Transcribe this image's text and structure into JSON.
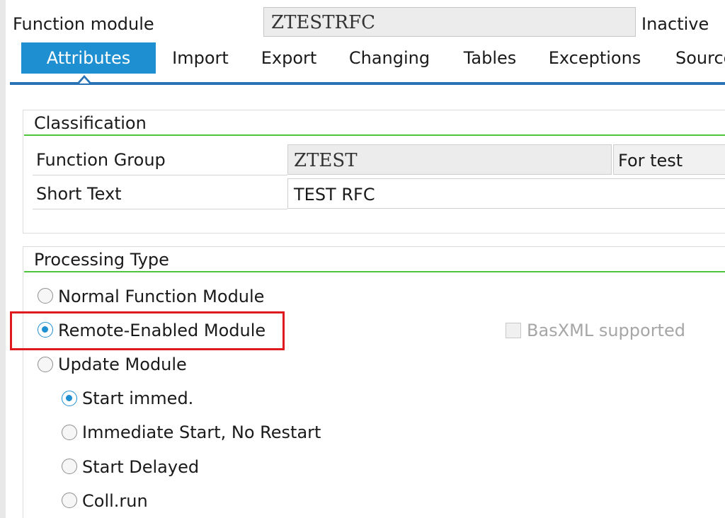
{
  "header": {
    "label": "Function module",
    "value": "ZTESTRFC",
    "status": "Inactive"
  },
  "tabs": [
    {
      "label": "Attributes",
      "active": true
    },
    {
      "label": "Import"
    },
    {
      "label": "Export"
    },
    {
      "label": "Changing"
    },
    {
      "label": "Tables"
    },
    {
      "label": "Exceptions"
    },
    {
      "label": "Source"
    }
  ],
  "classification": {
    "title": "Classification",
    "function_group_label": "Function Group",
    "function_group_value": "ZTEST",
    "function_group_desc": "For test",
    "short_text_label": "Short Text",
    "short_text_value": "TEST RFC"
  },
  "processing": {
    "title": "Processing Type",
    "options": [
      {
        "label": "Normal Function Module",
        "selected": false
      },
      {
        "label": "Remote-Enabled Module",
        "selected": true
      },
      {
        "label": "Update Module",
        "selected": false
      }
    ],
    "basxml_label": "BasXML supported",
    "basxml_checked": false,
    "update_options": [
      {
        "label": "Start immed.",
        "selected": true
      },
      {
        "label": "Immediate Start, No Restart",
        "selected": false
      },
      {
        "label": "Start Delayed",
        "selected": false
      },
      {
        "label": "Coll.run",
        "selected": false
      }
    ]
  },
  "colors": {
    "active_tab": "#1e8fd0",
    "section_line": "#4fc53c",
    "highlight": "#e0191e"
  }
}
